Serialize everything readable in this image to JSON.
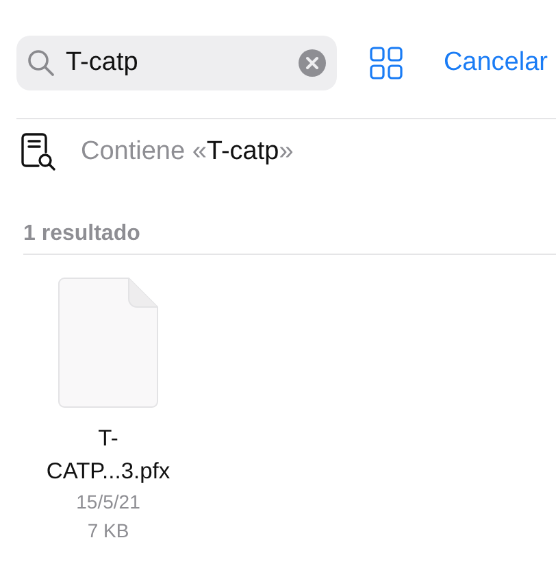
{
  "search": {
    "value": "T-catp"
  },
  "cancel": "Cancelar",
  "suggestion": {
    "prefix": "Contiene «",
    "query": "T-catp",
    "suffix": "»"
  },
  "results_header": "1 resultado",
  "files": [
    {
      "name": "T-CATP...3.pfx",
      "date": "15/5/21",
      "size": "7 KB"
    }
  ]
}
